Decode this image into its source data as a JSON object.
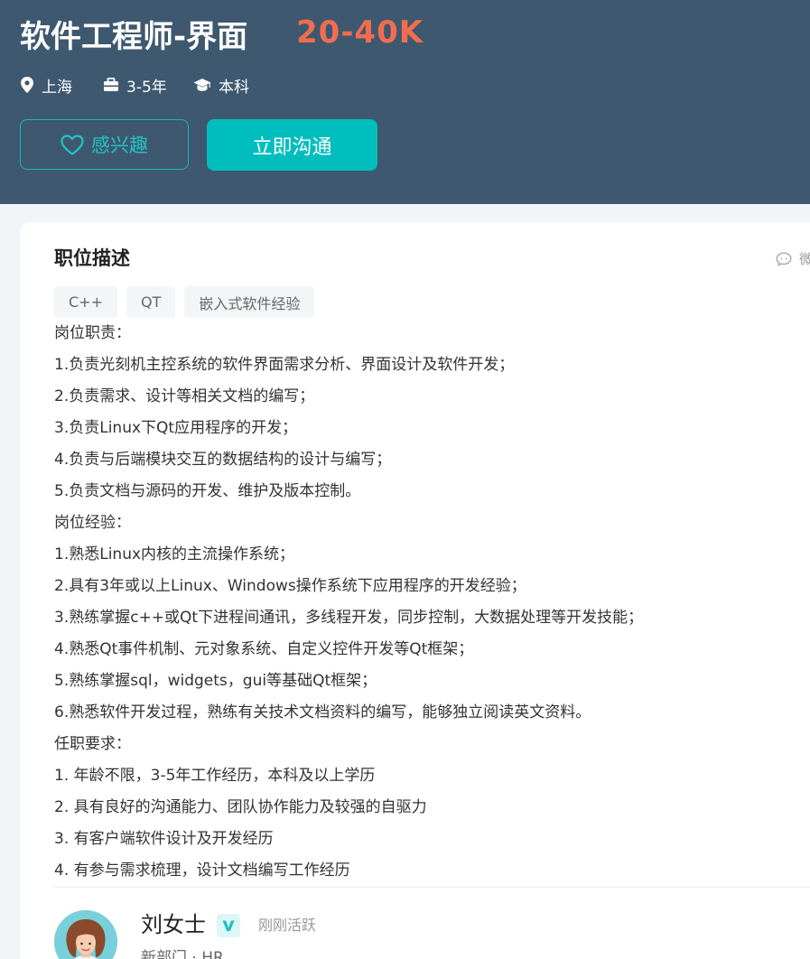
{
  "header": {
    "job_title": "软件工程师-界面",
    "salary": "20-40K",
    "city": "上海",
    "experience": "3-5年",
    "degree": "本科",
    "fav_label": "感兴趣",
    "chat_label": "立即沟通"
  },
  "colors": {
    "banner_bg": "#3e5870",
    "salary": "#f26d4f",
    "accent": "#00bebd"
  },
  "icons": [
    "location-icon",
    "briefcase-icon",
    "graduation-cap-icon",
    "heart-icon",
    "wechat-icon",
    "verified-icon"
  ],
  "description": {
    "section_title": "职位描述",
    "wechat_label": "微",
    "tags": [
      "C++",
      "QT",
      "嵌入式软件经验"
    ],
    "lines": [
      "岗位职责：",
      "1.负责光刻机主控系统的软件界面需求分析、界面设计及软件开发；",
      "2.负责需求、设计等相关文档的编写；",
      "3.负责Linux下Qt应用程序的开发；",
      "4.负责与后端模块交互的数据结构的设计与编写；",
      "5.负责文档与源码的开发、维护及版本控制。",
      "岗位经验：",
      "1.熟悉Linux内核的主流操作系统；",
      "2.具有3年或以上Linux、Windows操作系统下应用程序的开发经验；",
      "3.熟练掌握c++或Qt下进程间通讯，多线程开发，同步控制，大数据处理等开发技能；",
      "4.熟悉Qt事件机制、元对象系统、自定义控件开发等Qt框架；",
      "5.熟练掌握sql，widgets，gui等基础Qt框架；",
      "6.熟悉软件开发过程，熟练有关技术文档资料的编写，能够独立阅读英文资料。",
      "任职要求：",
      "1. 年龄不限，3-5年工作经历，本科及以上学历",
      "2. 具有良好的沟通能力、团队协作能力及较强的自驱力",
      "3. 有客户端软件设计及开发经历",
      "4. 有参与需求梳理，设计文档编写工作经历"
    ]
  },
  "recruiter": {
    "name": "刘女士",
    "status": "刚刚活跃",
    "title": "新部门 · HR"
  }
}
